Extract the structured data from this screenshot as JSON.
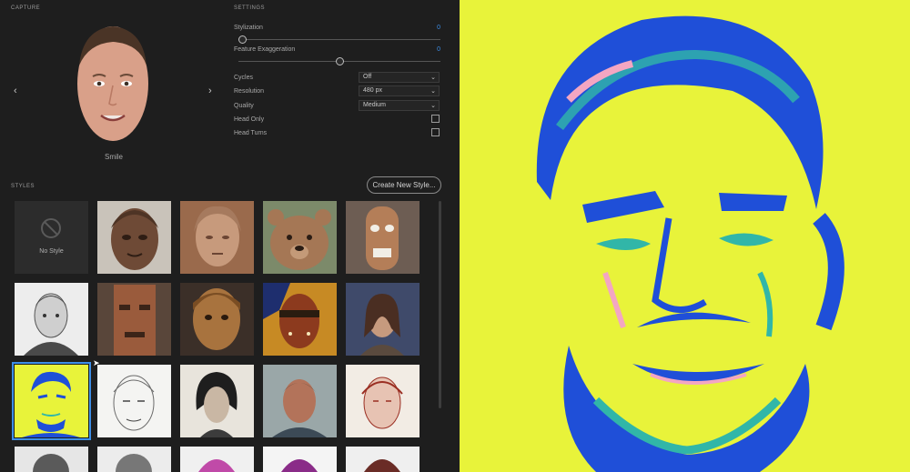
{
  "capture": {
    "title": "CAPTURE",
    "caption": "Smile",
    "prev_icon": "chevron-left-icon",
    "next_icon": "chevron-right-icon"
  },
  "settings": {
    "title": "SETTINGS",
    "stylization": {
      "label": "Stylization",
      "value": "0",
      "level": 0
    },
    "exaggeration": {
      "label": "Feature Exaggeration",
      "value": "0",
      "level": 0.5
    },
    "cycles": {
      "label": "Cycles",
      "value": "Off"
    },
    "resolution": {
      "label": "Resolution",
      "value": "480 px"
    },
    "quality": {
      "label": "Quality",
      "value": "Medium"
    },
    "head_only": {
      "label": "Head Only",
      "checked": false
    },
    "head_turns": {
      "label": "Head Turns",
      "checked": false
    }
  },
  "styles": {
    "title": "STYLES",
    "create_button": "Create New Style...",
    "no_style_label": "No Style",
    "tiles": [
      "no-style",
      "carved-wood-face",
      "carved-wood-head",
      "carved-bear",
      "wooden-mask",
      "pencil-man",
      "wooden-totem",
      "wooden-figurine",
      "painted-face",
      "oil-portrait-woman",
      "pop-art-selected",
      "line-sketch",
      "charcoal-woman",
      "old-man-painting",
      "red-ink-sketch",
      "partial-1",
      "partial-2",
      "partial-3",
      "partial-4",
      "partial-5"
    ],
    "selected_index": 10
  },
  "colors": {
    "accent": "#3d8ee8",
    "preview_bg": "#e8f33a",
    "preview_blue": "#1f4fd8",
    "preview_teal": "#31b6a8",
    "preview_pink": "#f3a6c2"
  }
}
